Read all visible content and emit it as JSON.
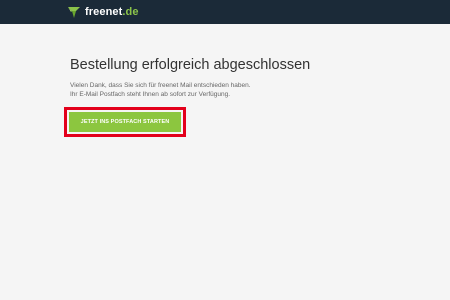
{
  "header": {
    "logo_name": "freenet",
    "logo_tld": ".de",
    "logo_icon": "freenet-leaf-icon",
    "background_color": "#1b2a38",
    "accent_color": "#8bc34a"
  },
  "main": {
    "title": "Bestellung erfolgreich abgeschlossen",
    "line1": "Vielen Dank, dass Sie sich für freenet Mail entschieden haben.",
    "line2": "Ihr E-Mail Postfach steht Ihnen ab sofort zur Verfügung.",
    "cta_label": "JETZT INS POSTFACH STARTEN",
    "cta_color": "#8cc63f",
    "highlight_color": "#e3001b"
  }
}
